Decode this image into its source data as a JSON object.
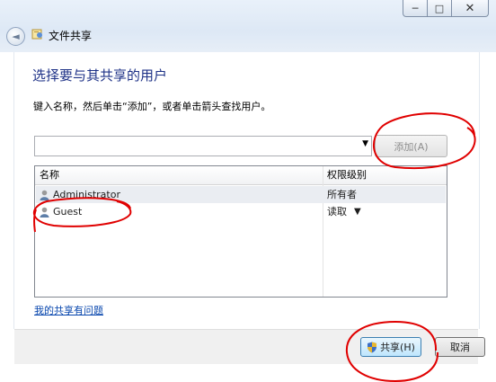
{
  "window": {
    "title": "文件共享",
    "controls": {
      "minimize": "─",
      "maximize": "□",
      "close": "✕"
    },
    "back_glyph": "◄"
  },
  "dialog": {
    "heading": "选择要与其共享的用户",
    "instruction": "键入名称，然后单击“添加”，或者单击箭头查找用户。",
    "input": {
      "value": "",
      "placeholder": ""
    },
    "add_button": "添加(A)",
    "columns": {
      "name": "名称",
      "permission": "权限级别"
    },
    "rows": [
      {
        "name": "Administrator",
        "permission": "所有者"
      },
      {
        "name": "Guest",
        "permission": "读取"
      }
    ],
    "help_link": "我的共享有问题",
    "share_button": "共享(H)",
    "cancel_button": "取消"
  },
  "colors": {
    "heading": "#1e3287",
    "annotation": "#e00000",
    "link": "#0645ad"
  },
  "icons": [
    "back-arrow-icon",
    "file-share-icon",
    "user-icon",
    "dropdown-arrow-icon",
    "shield-icon"
  ]
}
